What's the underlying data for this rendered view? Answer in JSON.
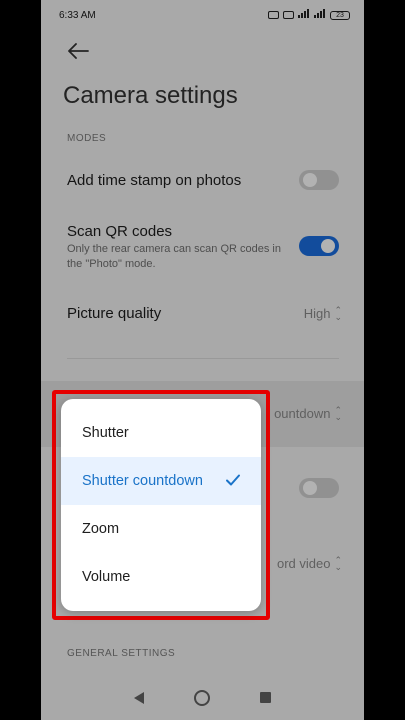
{
  "status_bar": {
    "time": "6:33 AM",
    "battery": "23"
  },
  "page": {
    "title": "Camera settings"
  },
  "sections": {
    "modes": "MODES",
    "general": "GENERAL SETTINGS"
  },
  "rows": {
    "timestamp": {
      "title": "Add time stamp on photos",
      "enabled": false
    },
    "scan_qr": {
      "title": "Scan QR codes",
      "subtitle": "Only the rear camera can scan QR codes in the \"Photo\" mode.",
      "enabled": true
    },
    "picture_quality": {
      "title": "Picture quality",
      "value": "High"
    },
    "volume_buttons": {
      "value": "ountdown"
    },
    "hidden_toggle": {
      "enabled": false
    },
    "volume_action": {
      "value": "ord video"
    }
  },
  "menu": {
    "items": [
      {
        "label": "Shutter",
        "selected": false
      },
      {
        "label": "Shutter countdown",
        "selected": true
      },
      {
        "label": "Zoom",
        "selected": false
      },
      {
        "label": "Volume",
        "selected": false
      }
    ]
  },
  "colors": {
    "accent": "#1a6ee0",
    "highlight_border": "#e60000",
    "selected_text": "#1a73c8"
  },
  "icons": {
    "back": "arrow-left-icon",
    "check": "check-icon",
    "chevron": "chevron-up-down-icon"
  }
}
